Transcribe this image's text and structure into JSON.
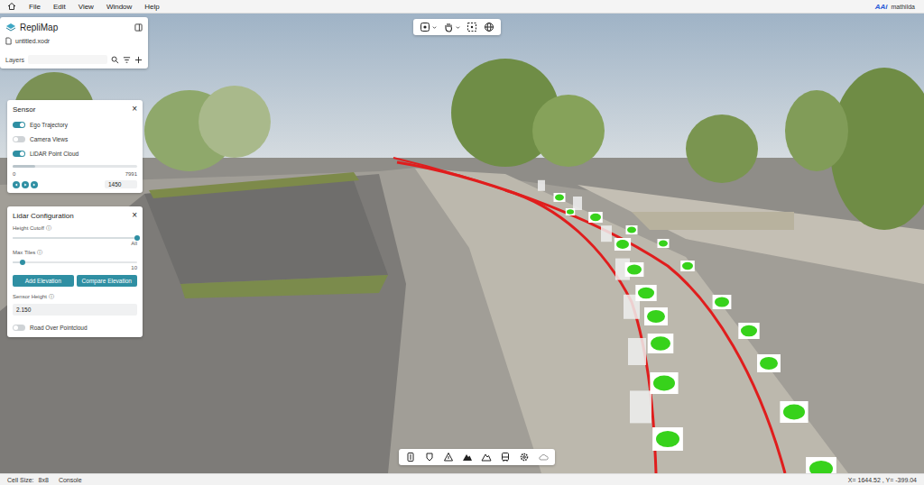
{
  "menu_bar": {
    "items": [
      "File",
      "Edit",
      "View",
      "Window",
      "Help"
    ],
    "brand_mark": "AAi",
    "brand": "mathilda"
  },
  "project_panel": {
    "title": "RepliMap",
    "file": "untitled.xodr",
    "layers_label": "Layers"
  },
  "sensor_panel": {
    "title": "Sensor",
    "close": "×",
    "toggles": [
      {
        "label": "Ego Trajectory",
        "on": true
      },
      {
        "label": "Camera Views",
        "on": false
      },
      {
        "label": "LiDAR Point Cloud",
        "on": true
      }
    ],
    "frame_slider": {
      "min": "0",
      "max": "7991",
      "level": 0.18,
      "value": "1450"
    }
  },
  "lidar_panel": {
    "title": "Lidar Configuration",
    "close": "×",
    "sliders": [
      {
        "label": "Height Cutoff",
        "info": "ⓘ",
        "level": 1.0,
        "end_label": "All"
      },
      {
        "label": "Max Tiles",
        "info": "ⓘ",
        "level": 0.08,
        "end_label": "10"
      }
    ],
    "buttons": [
      "Add Elevation",
      "Compare Elevation"
    ],
    "sensor_height": {
      "label": "Sensor Height",
      "info": "ⓘ",
      "value": "2.150"
    },
    "toggle": {
      "label": "Road Over Pointcloud",
      "on": false
    }
  },
  "status_bar": {
    "cell_size_label": "Cell Size:",
    "cell_size": "8x8",
    "console": "Console",
    "coords": "X= 1644.52 , Y= -399.04"
  }
}
